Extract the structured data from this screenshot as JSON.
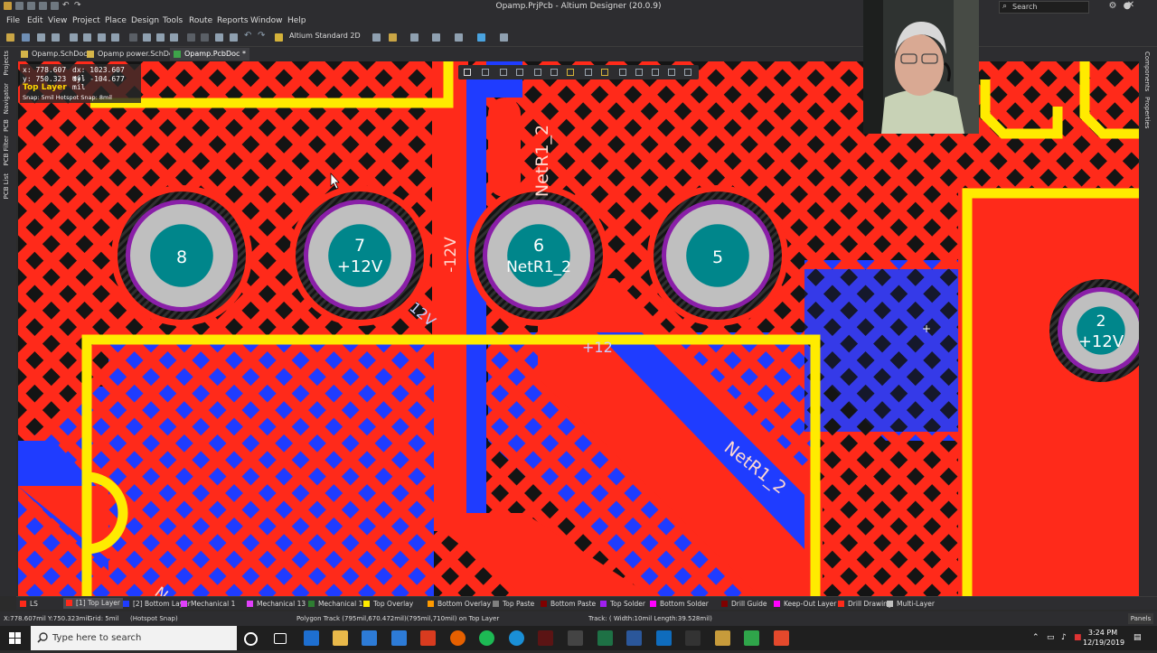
{
  "window": {
    "title": "Opamp.PrjPcb - Altium Designer (20.0.9)",
    "search_placeholder": "Search"
  },
  "menu": [
    "File",
    "Edit",
    "View",
    "Project",
    "Place",
    "Design",
    "Tools",
    "Route",
    "Reports",
    "Window",
    "Help"
  ],
  "toolbar": {
    "view_mode": "Altium Standard 2D"
  },
  "tabs": [
    {
      "label": "Opamp.SchDoc",
      "active": false
    },
    {
      "label": "Opamp power.SchDoc",
      "active": false
    },
    {
      "label": "Opamp.PcbDoc *",
      "active": true
    }
  ],
  "left_panels": [
    "Projects",
    "Navigator",
    "PCB",
    "PCB Filter",
    "PCB List"
  ],
  "right_panels": [
    "Components",
    "Properties"
  ],
  "hud": {
    "x": "x:  778.607",
    "dx": "dx:  1023.607 mil",
    "y": "y:  750.323",
    "dy": "dy:  -104.677  mil",
    "layer": "Top Layer",
    "snap": "Snap: 5mil Hotspot Snap: 8mil"
  },
  "pads": [
    {
      "number": "8",
      "net": ""
    },
    {
      "number": "7",
      "net": "+12V"
    },
    {
      "number": "6",
      "net": "NetR1_2"
    },
    {
      "number": "5",
      "net": ""
    },
    {
      "number": "2",
      "net": "+12V"
    }
  ],
  "net_labels": {
    "netr1_2_vertical": "NetR1_2",
    "minus12v": "-12V",
    "twelve_v": "12V",
    "plus12": "+12",
    "netr1_2_diag": "NetR1_2",
    "n_fragment": "N"
  },
  "layer_tabs": [
    {
      "label": "LS",
      "color": "#ff2a1a"
    },
    {
      "label": "[1] Top Layer",
      "color": "#ff2a1a",
      "active": true
    },
    {
      "label": "[2] Bottom Layer",
      "color": "#1f3cff"
    },
    {
      "label": "Mechanical 1",
      "color": "#e040fb"
    },
    {
      "label": "Mechanical 13",
      "color": "#e040fb"
    },
    {
      "label": "Mechanical 15",
      "color": "#2e7d32"
    },
    {
      "label": "Top Overlay",
      "color": "#ffeb00"
    },
    {
      "label": "Bottom Overlay",
      "color": "#ff9a00"
    },
    {
      "label": "Top Paste",
      "color": "#7f7f7f"
    },
    {
      "label": "Bottom Paste",
      "color": "#800000"
    },
    {
      "label": "Top Solder",
      "color": "#a020f0"
    },
    {
      "label": "Bottom Solder",
      "color": "#ff00ff"
    },
    {
      "label": "Drill Guide",
      "color": "#800000"
    },
    {
      "label": "Keep-Out Layer",
      "color": "#ff00ff"
    },
    {
      "label": "Drill Drawing",
      "color": "#ff2a1a"
    },
    {
      "label": "Multi-Layer",
      "color": "#c0c0c0"
    }
  ],
  "status": {
    "coords": "X:778.607mil Y:750.323mil",
    "grid": "Grid: 5mil",
    "snap": "(Hotspot Snap)",
    "object": "Polygon Track (795mil,670.472mil)(795mil,710mil) on Top Layer",
    "track": "Track: ( Width:10mil Length:39.528mil)",
    "panels": "Panels"
  },
  "taskbar": {
    "search_placeholder": "Type here to search",
    "time": "3:24 PM",
    "date": "12/19/2019"
  },
  "colors": {
    "top_copper": "#ff2a1a",
    "bottom_copper": "#1f3cff",
    "overlay": "#ffeb00",
    "pad": "#bfbfbf",
    "pad_hole": "#00868b",
    "multilayer_ring": "#8a1fa8"
  }
}
